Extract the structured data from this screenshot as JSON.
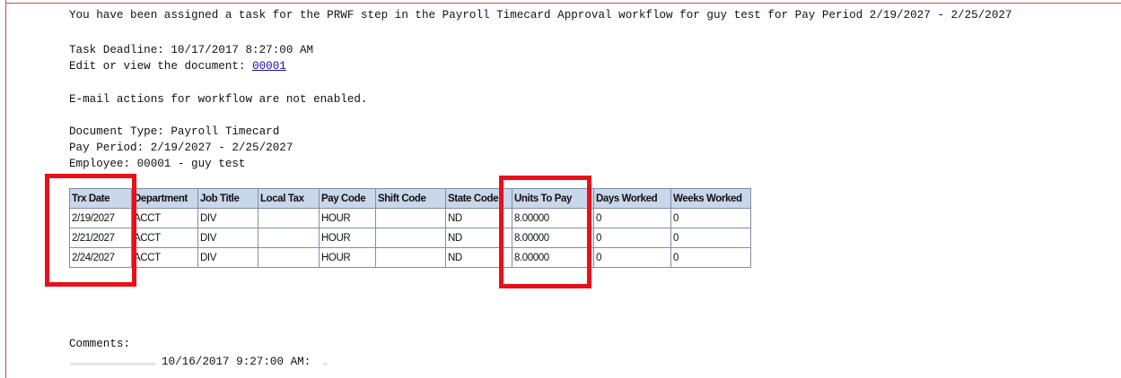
{
  "top_fragment": "",
  "message": {
    "intro": "You have been assigned a task for the PRWF step in the Payroll Timecard Approval workflow for guy test for Pay Period 2/19/2027 - 2/25/2027",
    "deadline": "Task Deadline: 10/17/2017 8:27:00 AM",
    "edit_prefix": "Edit or view the document: ",
    "document_link": "00001",
    "email_actions": "E-mail actions for workflow are not enabled.",
    "document_type": "Document Type: Payroll Timecard",
    "pay_period": "Pay Period: 2/19/2027 - 2/25/2027",
    "employee": "Employee: 00001 - guy test",
    "comments_label": "Comments:",
    "comment_entry": "10/16/2017 9:27:00 AM:"
  },
  "table": {
    "headers": [
      "Trx Date",
      "Department",
      "Job Title",
      "Local Tax",
      "Pay Code",
      "Shift Code",
      "State Code",
      "Units To Pay",
      "Days Worked",
      "Weeks Worked"
    ],
    "rows": [
      [
        "2/19/2027",
        "ACCT",
        "DIV",
        "",
        "HOUR",
        "",
        "ND",
        "8.00000",
        "0",
        "0"
      ],
      [
        "2/21/2027",
        "ACCT",
        "DIV",
        "",
        "HOUR",
        "",
        "ND",
        "8.00000",
        "0",
        "0"
      ],
      [
        "2/24/2027",
        "ACCT",
        "DIV",
        "",
        "HOUR",
        "",
        "ND",
        "8.00000",
        "0",
        "0"
      ]
    ]
  },
  "highlights": [
    "Trx Date",
    "Units To Pay"
  ],
  "colors": {
    "highlight": "#e8101a",
    "header_bg": "#c9d7ea",
    "link": "#1a0dab"
  }
}
